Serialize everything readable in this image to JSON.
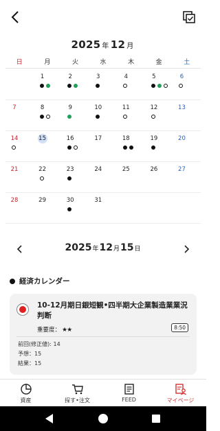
{
  "header": {
    "back_icon": "chevron-left-icon",
    "copy_icon": "copy-icon"
  },
  "calendar": {
    "year": "2025",
    "year_unit": "年",
    "month": "12",
    "month_unit": "月",
    "weekdays": [
      "日",
      "月",
      "火",
      "水",
      "木",
      "金",
      "土"
    ],
    "weeks": [
      [
        {
          "day": "",
          "marks": []
        },
        {
          "day": "1",
          "marks": [
            "filled",
            "green"
          ]
        },
        {
          "day": "2",
          "marks": [
            "filled",
            "green"
          ]
        },
        {
          "day": "3",
          "marks": [
            "filled"
          ]
        },
        {
          "day": "4",
          "marks": [
            "empty"
          ]
        },
        {
          "day": "5",
          "marks": [
            "filled",
            "green",
            "empty"
          ]
        },
        {
          "day": "6",
          "marks": [
            "empty"
          ]
        }
      ],
      [
        {
          "day": "7",
          "marks": []
        },
        {
          "day": "8",
          "marks": [
            "filled",
            "empty"
          ]
        },
        {
          "day": "9",
          "marks": [
            "green"
          ]
        },
        {
          "day": "10",
          "marks": [
            "filled"
          ]
        },
        {
          "day": "11",
          "marks": [
            "empty"
          ]
        },
        {
          "day": "12",
          "marks": [
            "empty"
          ]
        },
        {
          "day": "13",
          "marks": []
        }
      ],
      [
        {
          "day": "14",
          "marks": [
            "empty"
          ]
        },
        {
          "day": "15",
          "marks": [],
          "selected": true
        },
        {
          "day": "16",
          "marks": [
            "filled",
            "empty"
          ]
        },
        {
          "day": "17",
          "marks": []
        },
        {
          "day": "18",
          "marks": [
            "filled",
            "filled"
          ]
        },
        {
          "day": "19",
          "marks": [
            "filled"
          ]
        },
        {
          "day": "20",
          "marks": []
        }
      ],
      [
        {
          "day": "21",
          "marks": []
        },
        {
          "day": "22",
          "marks": [
            "empty"
          ]
        },
        {
          "day": "23",
          "marks": [
            "filled"
          ]
        },
        {
          "day": "24",
          "marks": []
        },
        {
          "day": "25",
          "marks": []
        },
        {
          "day": "26",
          "marks": []
        },
        {
          "day": "27",
          "marks": []
        }
      ],
      [
        {
          "day": "28",
          "marks": []
        },
        {
          "day": "29",
          "marks": []
        },
        {
          "day": "30",
          "marks": [
            "filled"
          ]
        },
        {
          "day": "31",
          "marks": []
        },
        {
          "day": "",
          "marks": []
        },
        {
          "day": "",
          "marks": []
        },
        {
          "day": "",
          "marks": []
        }
      ]
    ]
  },
  "date_nav": {
    "year": "2025",
    "year_unit": "年",
    "month": "12",
    "month_unit": "月",
    "day": "15",
    "day_unit": "日"
  },
  "section": {
    "title": "経済カレンダー"
  },
  "event": {
    "title": "10-12月期日銀短観•四半期大企業製造業業況判断",
    "importance_label": "重要度：",
    "importance_stars": "★★",
    "time": "8:50",
    "previous": "前回(修正値): 14",
    "forecast": "予想：15",
    "result": "結果：15"
  },
  "bottom_nav": [
    {
      "label": "資産",
      "icon": "pie-chart-icon"
    },
    {
      "label": "探す•注文",
      "icon": "cart-icon"
    },
    {
      "label": "FEED",
      "icon": "newspaper-icon"
    },
    {
      "label": "マイページ",
      "icon": "user-doc-icon",
      "active": true
    }
  ],
  "colors": {
    "sunday": "#c8212b",
    "saturday": "#2a5fb3",
    "green_mark": "#22a05a",
    "selected_day": "#cfe0f7",
    "active_nav": "#d03434"
  }
}
